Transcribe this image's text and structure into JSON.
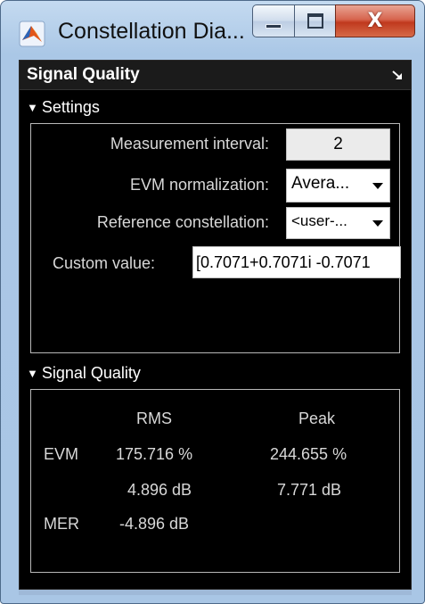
{
  "window": {
    "title": "Constellation Dia...",
    "buttons": {
      "minimize": "minimize-icon",
      "maximize": "maximize-icon",
      "close": "X"
    }
  },
  "panel": {
    "title": "Signal Quality",
    "undock_icon": "undock-arrow-icon"
  },
  "settings": {
    "header": "Settings",
    "measurement_interval": {
      "label": "Measurement interval:",
      "value": "2"
    },
    "evm_normalization": {
      "label": "EVM normalization:",
      "value": "Avera..."
    },
    "reference_constellation": {
      "label": "Reference constellation:",
      "value": "<user-..."
    },
    "custom_value": {
      "label": "Custom value:",
      "value": "[0.7071+0.7071i -0.7071"
    }
  },
  "signal_quality": {
    "header": "Signal Quality",
    "columns": {
      "rms": "RMS",
      "peak": "Peak"
    },
    "rows": [
      {
        "label": "EVM",
        "rms": "175.716 %",
        "peak": "244.655 %"
      },
      {
        "label": "",
        "rms": "4.896 dB",
        "peak": "7.771 dB"
      },
      {
        "label": "MER",
        "rms": "-4.896 dB",
        "peak": ""
      }
    ]
  },
  "colors": {
    "panel_bg": "#000000",
    "text": "#d8d8d8",
    "close_button": "#c0391e",
    "window_frame": "#aac7e6"
  }
}
